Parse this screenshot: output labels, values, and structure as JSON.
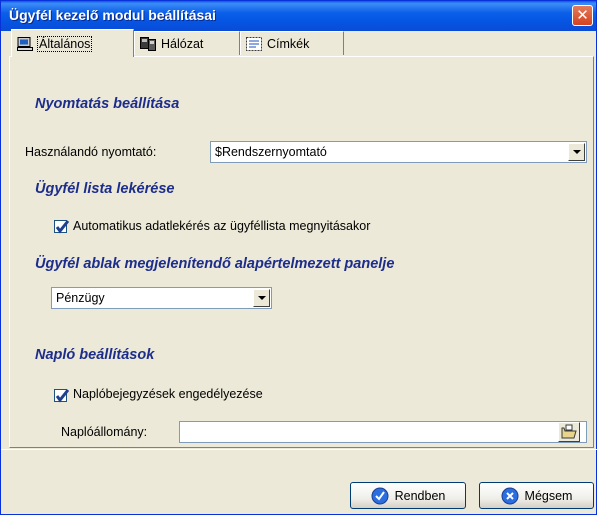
{
  "window": {
    "title": "Ügyfél kezelő modul beállításai",
    "close_glyph": "✕"
  },
  "tabs": [
    {
      "label": "Általános",
      "icon": "computer-icon",
      "active": true
    },
    {
      "label": "Hálózat",
      "icon": "network-icon",
      "active": false
    },
    {
      "label": "Címkék",
      "icon": "labels-icon",
      "active": false
    }
  ],
  "print_section": {
    "heading": "Nyomtatás beállítása",
    "printer_label": "Használandó nyomtató:",
    "printer_value": "$Rendszernyomtató"
  },
  "list_section": {
    "heading": "Ügyfél lista lekérése",
    "auto_fetch_label": "Automatikus adatlekérés az ügyféllista megnyitásakor",
    "auto_fetch_checked": true
  },
  "panel_section": {
    "heading": "Ügyfél ablak megjelenítendő alapértelmezett panelje",
    "panel_value": "Pénzügy"
  },
  "log_section": {
    "heading": "Napló beállítások",
    "enable_label": "Naplóbejegyzések engedélyezése",
    "enable_checked": true,
    "file_label": "Naplóállomány:",
    "file_value": ""
  },
  "buttons": {
    "ok": "Rendben",
    "cancel": "Mégsem"
  },
  "colors": {
    "heading": "#1c2d8c",
    "titlebar": "#0a5fe8",
    "accent_button": "#2c6de0"
  }
}
